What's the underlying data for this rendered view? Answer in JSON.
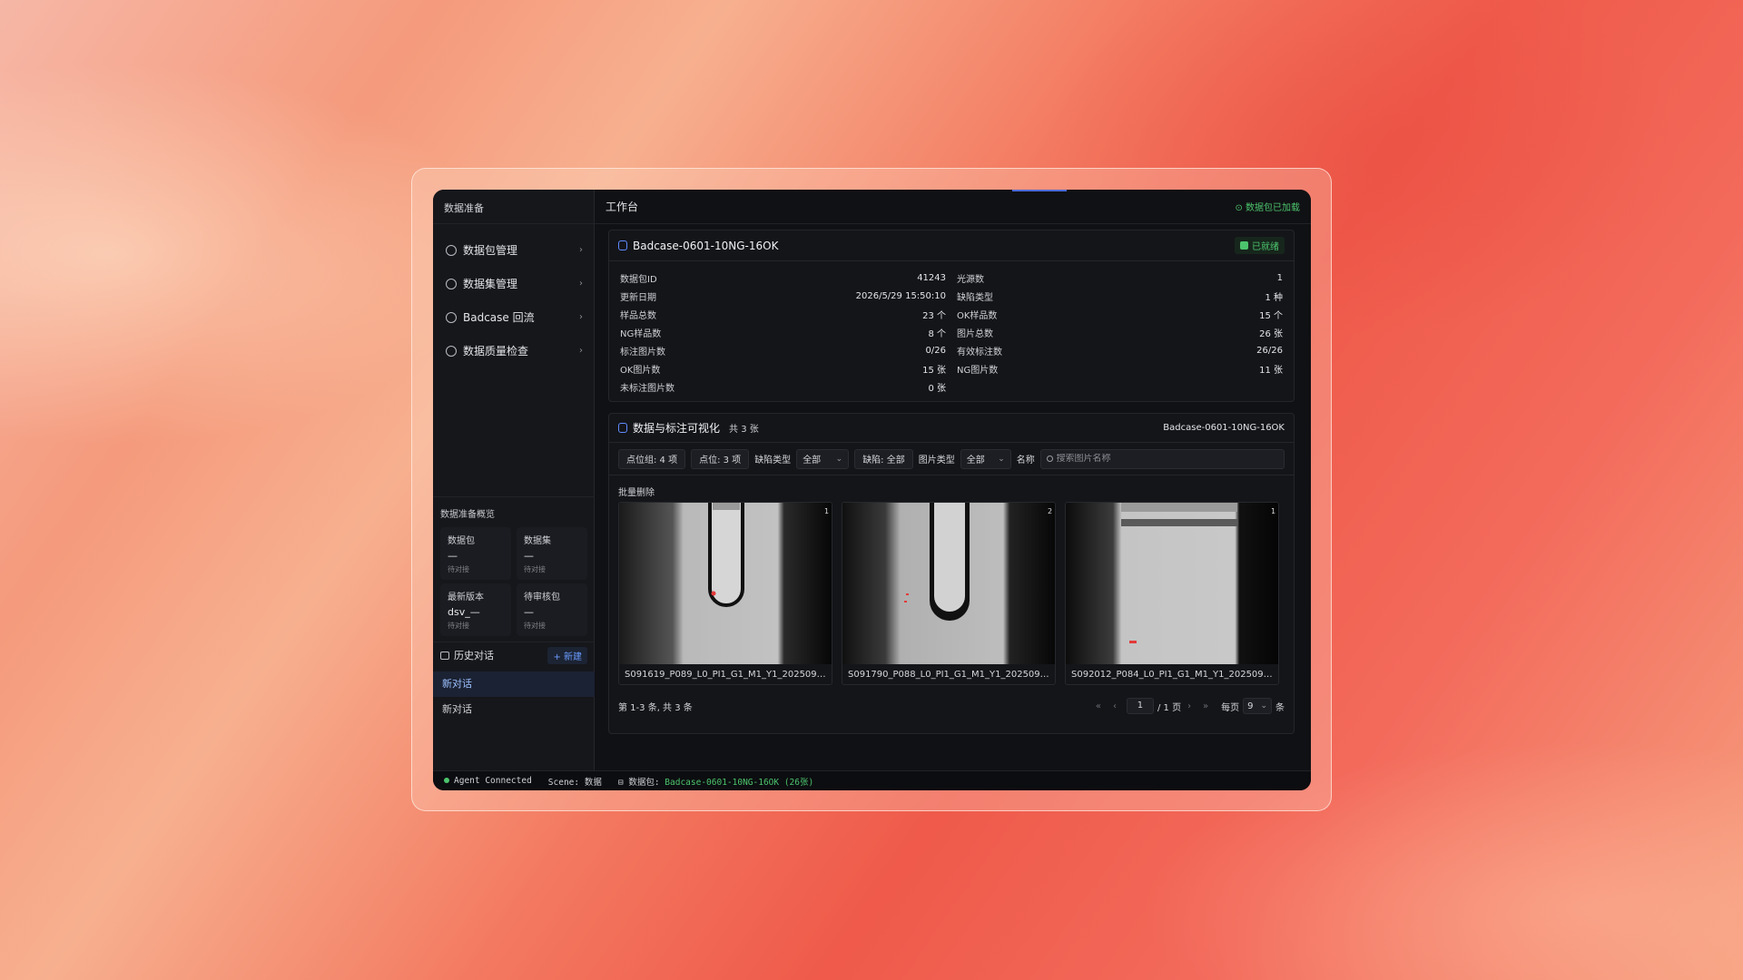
{
  "sidebar": {
    "title": "数据准备",
    "nav": [
      {
        "label": "数据包管理",
        "icon": "package-icon"
      },
      {
        "label": "数据集管理",
        "icon": "layers-icon"
      },
      {
        "label": "Badcase 回流",
        "icon": "alert-circle-icon"
      },
      {
        "label": "数据质量检查",
        "icon": "check-circle-icon"
      }
    ],
    "overview": {
      "title": "数据准备概览",
      "cells": [
        {
          "key": "数据包",
          "value": "—",
          "sub": "待对接"
        },
        {
          "key": "数据集",
          "value": "—",
          "sub": "待对接"
        },
        {
          "key": "最新版本",
          "value": "dsv_—",
          "sub": "待对接"
        },
        {
          "key": "待审核包",
          "value": "—",
          "sub": "待对接"
        }
      ]
    },
    "history": {
      "title": "历史对话",
      "new_label": "+ 新建",
      "items": [
        "新对话",
        "新对话"
      ]
    }
  },
  "topbar": {
    "title": "工作台",
    "status": "⊙ 数据包已加载"
  },
  "package": {
    "name": "Badcase-0601-10NG-16OK",
    "ready_label": "已就绪",
    "left": [
      {
        "k": "数据包ID",
        "v": "41243"
      },
      {
        "k": "更新日期",
        "v": "2026/5/29 15:50:10"
      },
      {
        "k": "样品总数",
        "v": "23 个"
      },
      {
        "k": "NG样品数",
        "v": "8 个"
      },
      {
        "k": "标注图片数",
        "v": "0/26"
      },
      {
        "k": "OK图片数",
        "v": "15 张"
      },
      {
        "k": "未标注图片数",
        "v": "0 张"
      }
    ],
    "right": [
      {
        "k": "光源数",
        "v": "1"
      },
      {
        "k": "缺陷类型",
        "v": "1 种"
      },
      {
        "k": "OK样品数",
        "v": "15 个"
      },
      {
        "k": "图片总数",
        "v": "26 张"
      },
      {
        "k": "有效标注数",
        "v": "26/26"
      },
      {
        "k": "NG图片数",
        "v": "11 张"
      }
    ]
  },
  "viz": {
    "title": "数据与标注可视化",
    "count": "共 3 张",
    "package": "Badcase-0601-10NG-16OK",
    "filters": {
      "point_group": "点位组:  4 项",
      "point": "点位:  3 项",
      "defect_type_label": "缺陷类型",
      "defect_type_value": "全部",
      "defect_chip": "缺陷:  全部",
      "image_type_label": "图片类型",
      "image_type_value": "全部",
      "name_label": "名称",
      "search_placeholder": "搜索图片名称"
    },
    "batch_delete": "批量删除",
    "images": [
      {
        "badge": "1",
        "caption": "S091619_P089_L0_PI1_G1_M1_Y1_20250925..."
      },
      {
        "badge": "2",
        "caption": "S091790_P088_L0_PI1_G1_M1_Y1_20250925..."
      },
      {
        "badge": "1",
        "caption": "S092012_P084_L0_PI1_G1_M1_Y1_2025092..."
      }
    ],
    "pager": {
      "range": "第 1-3 条, 共 3 条",
      "first": "«",
      "prev": "‹",
      "next": "›",
      "last": "»",
      "page": "1",
      "total": "/ 1 页",
      "per_page_label": "每页",
      "per_page": "9",
      "per_page_unit": "条"
    }
  },
  "statusbar": {
    "agent": "Agent Connected",
    "scene": "Scene: 数据",
    "pkg_label": "数据包:",
    "pkg_value": "Badcase-0601-10NG-16OK (26张)"
  },
  "colors": {
    "accent": "#5f8bff",
    "ok": "#4cc46d",
    "bg": "#101114"
  }
}
